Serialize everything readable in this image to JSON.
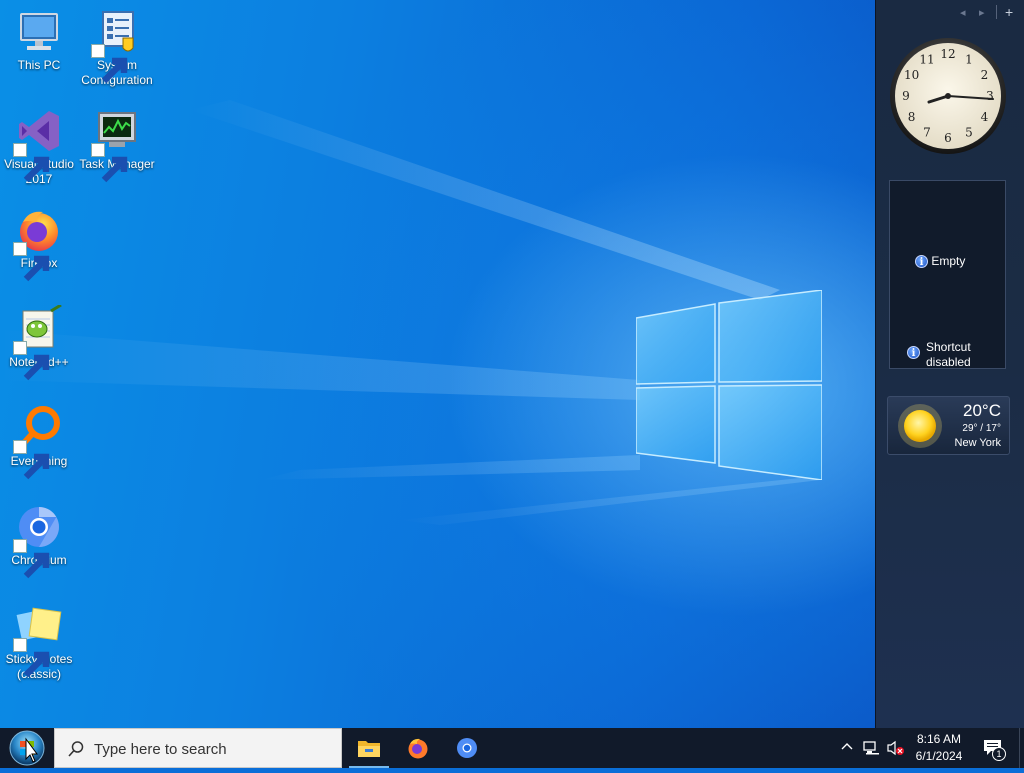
{
  "desktop": {
    "icons": [
      {
        "label": "This PC",
        "icon": "this-pc-icon"
      },
      {
        "label": "System\nConfiguration",
        "icon": "system-configuration-icon"
      },
      {
        "label": "Visual Studio\n2017",
        "icon": "visual-studio-icon"
      },
      {
        "label": "Task Manager",
        "icon": "task-manager-icon"
      },
      {
        "label": "Firefox",
        "icon": "firefox-icon"
      },
      {
        "label": "Notepad++",
        "icon": "notepad-plus-plus-icon"
      },
      {
        "label": "Everything",
        "icon": "everything-icon"
      },
      {
        "label": "Chromium",
        "icon": "chromium-icon"
      },
      {
        "label": "Sticky Notes\n(classic)",
        "icon": "sticky-notes-icon"
      }
    ]
  },
  "sidebar": {
    "controls": {
      "prev": "◂",
      "next": "▸",
      "add": "+"
    },
    "clock": {
      "time": "8:16",
      "numerals": [
        "12",
        "1",
        "2",
        "3",
        "4",
        "5",
        "6",
        "7",
        "8",
        "9",
        "10",
        "11"
      ]
    },
    "slideshow": {
      "status": "Empty",
      "note_line1": "Shortcut",
      "note_line2": "disabled"
    },
    "weather": {
      "temperature": "20°C",
      "range": "29° / 17°",
      "city": "New York"
    }
  },
  "taskbar": {
    "search_placeholder": "Type here to search",
    "pinned": [
      {
        "name": "file-explorer",
        "active": true
      },
      {
        "name": "firefox",
        "active": false
      },
      {
        "name": "chromium",
        "active": false
      }
    ],
    "tray": {
      "time": "8:16 AM",
      "date": "6/1/2024",
      "notification_count": "1"
    }
  }
}
